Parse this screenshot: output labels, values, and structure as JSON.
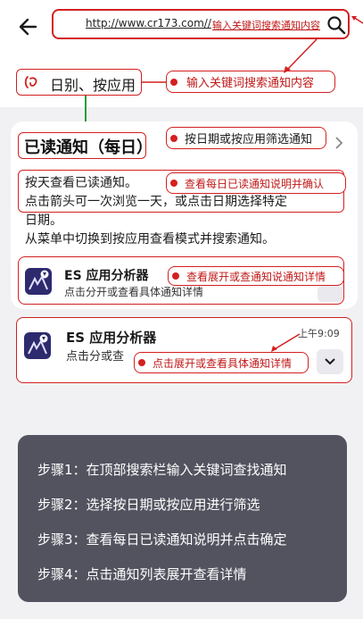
{
  "header": {
    "back_icon": "arrow-left-icon",
    "url": "http://www.cr173.com//",
    "search_annotation": "输入关键词搜索通知内容",
    "search_icon": "search-icon"
  },
  "filter": {
    "label": "日别、按应用",
    "icon": "calendar-app-icon"
  },
  "annotations": {
    "filter_callout": "输入关键词搜索通知内容",
    "title_callout": "按日期或按应用筛选通知",
    "desc_callout": "查看每日已读通知说明并确认",
    "row1_callout": "查看展开或查通知说通知详情",
    "row2_callout": "点击展开或查看具体通知详情"
  },
  "info_card": {
    "title": "已读通知（每日）",
    "description_lines": [
      "按天查看已读通知。",
      "点击箭头可一次浏览一天，或点击日期选择特定",
      "日期。",
      "从菜单中切换到按应用查看模式并搜索通知。"
    ],
    "chevron_icon": "chevron-right-icon"
  },
  "notifications": [
    {
      "app_name": "ES 应用分析器",
      "detail": "点击分开或查看具体通知详情",
      "time": ""
    },
    {
      "app_name": "ES 应用分析器",
      "detail": "点击分或查",
      "time": "上午9:09"
    }
  ],
  "steps": [
    "步骤1：在顶部搜索栏输入关键词查找通知",
    "步骤2：选择按日期或按应用进行筛选",
    "步骤3：查看每日已读通知说明并点击确定",
    "步骤4：点击通知列表展开查看详情"
  ],
  "colors": {
    "annotation_red": "#d32020",
    "overlay": "#52535f",
    "app_icon_bg": "#2d2a6e"
  }
}
